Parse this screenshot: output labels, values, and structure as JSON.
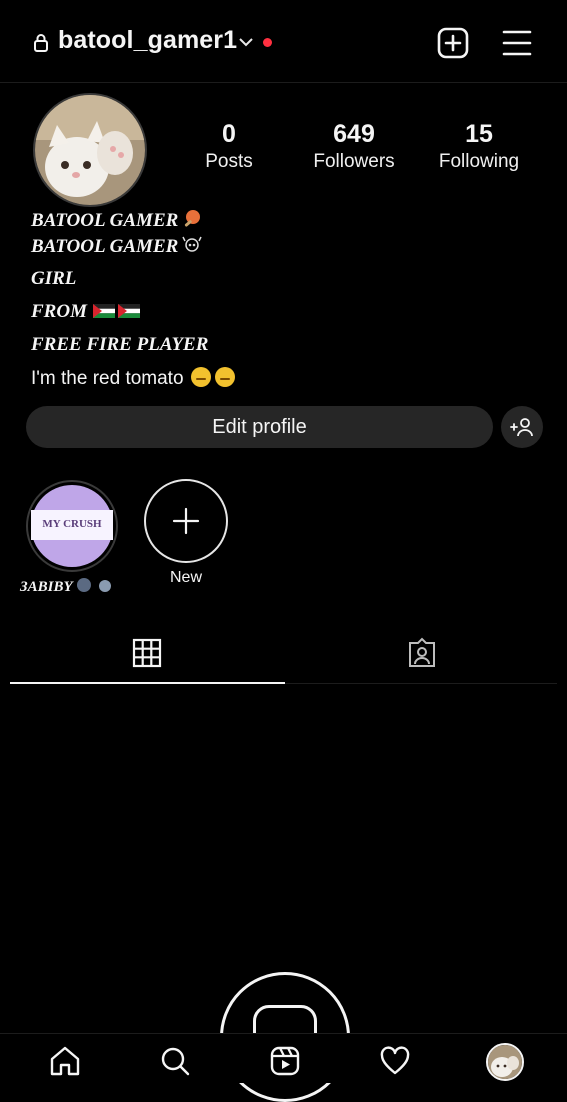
{
  "header": {
    "username": "batool_gamer1",
    "icons": [
      "lock-icon",
      "chevron-down-icon",
      "notification-dot",
      "new-post-icon",
      "menu-icon"
    ]
  },
  "profile": {
    "stats": [
      {
        "value": "0",
        "label": "Posts"
      },
      {
        "value": "649",
        "label": "Followers"
      },
      {
        "value": "15",
        "label": "Following"
      }
    ],
    "bio": {
      "line1": "BATOOL GAMER",
      "line2": "BATOOL GAMER",
      "line3": "GIRL",
      "line4": "FROM",
      "line5": "FREE FIRE PLAYER",
      "line6": "I'm the red tomato"
    },
    "edit_profile_label": "Edit profile"
  },
  "highlights": [
    {
      "cover_text": "MY CRUSH",
      "label": "ЗABIBY"
    },
    {
      "label": "New"
    }
  ],
  "tabs": [
    {
      "name": "grid",
      "icon": "grid-icon",
      "active": true
    },
    {
      "name": "tagged",
      "icon": "tagged-icon",
      "active": false
    }
  ],
  "bottom_nav": [
    "home-icon",
    "search-icon",
    "reels-icon",
    "heart-icon",
    "profile-avatar"
  ],
  "colors": {
    "background": "#000000",
    "button_bg": "#262626",
    "notification_dot": "#ff3040",
    "text": "#f5f5f5"
  }
}
